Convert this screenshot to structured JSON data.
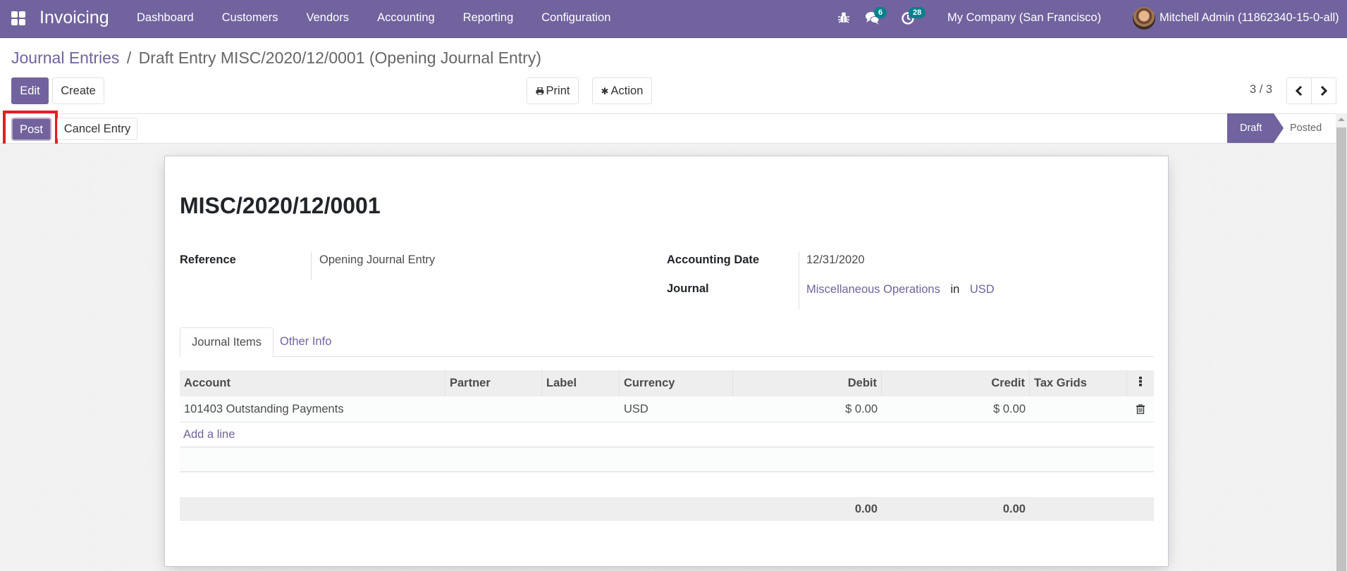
{
  "navbar": {
    "app_name": "Invoicing",
    "menu": [
      "Dashboard",
      "Customers",
      "Vendors",
      "Accounting",
      "Reporting",
      "Configuration"
    ],
    "chat_badge": "6",
    "activity_badge": "28",
    "company": "My Company (San Francisco)",
    "user": "Mitchell Admin (11862340-15-0-all)",
    "icons": {
      "apps": "apps-grid-icon",
      "debug": "bug-icon",
      "chat": "chat-icon",
      "activity": "clock-icon"
    }
  },
  "breadcrumb": {
    "parent": "Journal Entries",
    "separator": "/",
    "current": "Draft Entry MISC/2020/12/0001 (Opening Journal Entry)"
  },
  "toolbar": {
    "edit_label": "Edit",
    "create_label": "Create",
    "print_label": "Print",
    "action_label": "Action",
    "pager": "3 / 3"
  },
  "statusbar": {
    "post_label": "Post",
    "cancel_label": "Cancel Entry",
    "stages": [
      "Draft",
      "Posted"
    ],
    "current_stage": "Draft"
  },
  "form": {
    "title": "MISC/2020/12/0001",
    "reference_label": "Reference",
    "reference_value": "Opening Journal Entry",
    "date_label": "Accounting Date",
    "date_value": "12/31/2020",
    "journal_label": "Journal",
    "journal_value": "Miscellaneous Operations",
    "journal_in": "in",
    "journal_currency": "USD"
  },
  "tabs": [
    "Journal Items",
    "Other Info"
  ],
  "table": {
    "columns": [
      "Account",
      "Partner",
      "Label",
      "Currency",
      "Debit",
      "Credit",
      "Tax Grids"
    ],
    "rows": [
      {
        "account": "101403 Outstanding Payments",
        "partner": "",
        "label": "",
        "currency": "USD",
        "debit": "$ 0.00",
        "credit": "$ 0.00",
        "tax_grids": ""
      }
    ],
    "add_line": "Add a line",
    "totals": {
      "debit": "0.00",
      "credit": "0.00"
    }
  },
  "colors": {
    "brand": "#71639e",
    "badge": "#00828c",
    "highlight": "#e31e24"
  }
}
